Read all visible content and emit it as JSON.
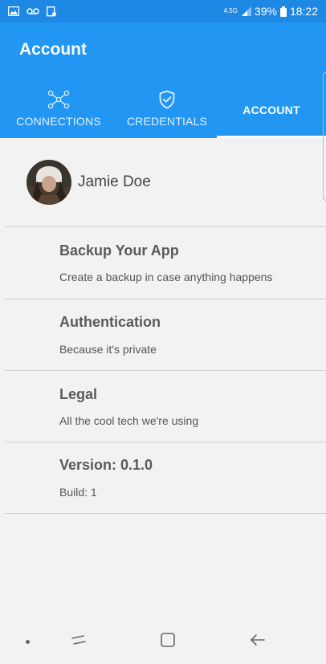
{
  "status_bar": {
    "network_type": "4.5G",
    "battery": "39%",
    "time": "18:22"
  },
  "app_bar": {
    "title": "Account"
  },
  "tabs": [
    {
      "label": "CONNECTIONS",
      "icon": "connections-network-icon"
    },
    {
      "label": "CREDENTIALS",
      "icon": "shield-check-icon"
    },
    {
      "label": "ACCOUNT",
      "icon": null,
      "selected": true
    }
  ],
  "profile": {
    "name": "Jamie Doe"
  },
  "menu_items": [
    {
      "title": "Backup Your App",
      "subtitle": "Create a backup in case anything happens"
    },
    {
      "title": "Authentication",
      "subtitle": "Because it's private"
    },
    {
      "title": "Legal",
      "subtitle": "All the cool tech we're using"
    },
    {
      "title": "Version: 0.1.0",
      "subtitle": "Build: 1"
    }
  ],
  "colors": {
    "status_bar": "#1e88e5",
    "app_bar": "#2196f3",
    "background": "#f2f2f2"
  }
}
